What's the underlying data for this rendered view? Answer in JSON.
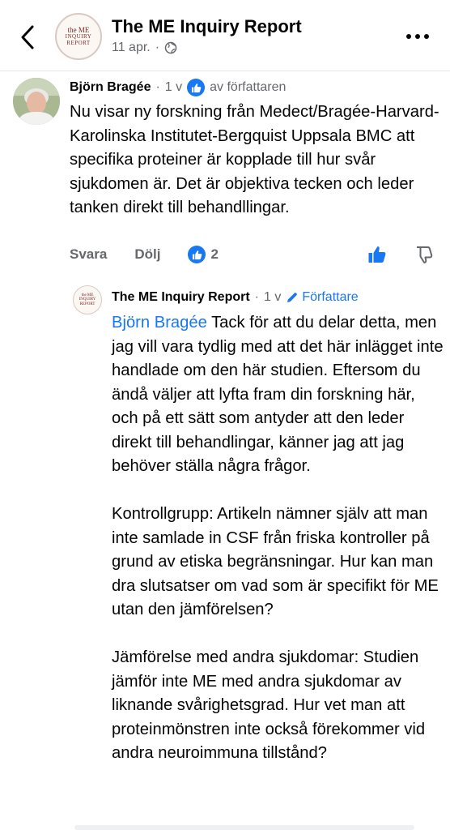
{
  "header": {
    "page_name": "The ME Inquiry Report",
    "date": "11 apr.",
    "separator": "·",
    "logo": {
      "line1": "the ME",
      "line2": "INQUIRY",
      "line3": "REPORT"
    }
  },
  "comment": {
    "author": "Björn Bragée",
    "sep": "·",
    "age": "1 v",
    "author_label": "av författaren",
    "text": "Nu visar ny forskning från Medect/Bragée-Harvard-Karolinska Institutet-Bergquist Uppsala BMC att specifika proteiner är kopplade till hur svår sjukdomen är. Det är objektiva tecken och leder tanken direkt till behandllingar.",
    "actions": {
      "reply": "Svara",
      "hide": "Dölj",
      "reaction_count": "2"
    }
  },
  "reply": {
    "author": "The ME Inquiry Report",
    "sep": "·",
    "age": "1 v",
    "badge": "Författare",
    "mention": "Björn Bragée",
    "p1": "Tack för att du delar detta, men jag vill vara tydlig med att det här inlägget inte handlade om den här studien. Eftersom du ändå väljer att lyfta fram din forskning här, och på ett sätt som antyder att den leder direkt till behandlingar, känner jag att jag behöver ställa några frågor.",
    "p2": "Kontrollgrupp: Artikeln nämner själv att man inte samlade in CSF från friska kontroller på grund av etiska begränsningar. Hur kan man dra slutsatser om vad som är specifikt för ME utan den jämförelsen?",
    "p3": "Jämförelse med andra sjukdomar: Studien jämför inte ME med andra sjukdomar av liknande svårighetsgrad. Hur vet man att proteinmönstren inte också förekommer vid andra neuroimmuna tillstånd?",
    "logo": {
      "line1": "the ME",
      "line2": "INQUIRY",
      "line3": "REPORT"
    }
  },
  "colors": {
    "accent": "#1877f2",
    "secondary_text": "#65676b",
    "logo_text": "#7a2a26"
  },
  "icons": {
    "back": "chevron-left-icon",
    "globe": "globe-icon",
    "more": "more-icon",
    "like": "thumbs-up-icon",
    "dislike": "thumbs-down-icon",
    "pencil": "pencil-icon"
  }
}
